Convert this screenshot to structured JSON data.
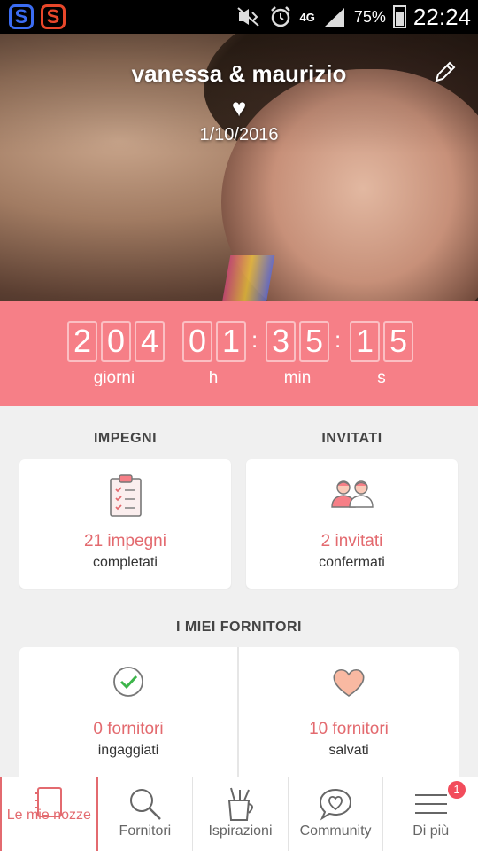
{
  "status_bar": {
    "app1_letter": "S",
    "app2_letter": "S",
    "network": "4G",
    "battery": "75%",
    "time": "22:24"
  },
  "hero": {
    "couple_names": "vanessa & maurizio",
    "heart_icon": "heart-icon",
    "date": "1/10/2016",
    "edit_icon": "pencil-icon"
  },
  "countdown": {
    "days_digits": [
      "2",
      "0",
      "4"
    ],
    "hours_digits": [
      "0",
      "1"
    ],
    "minutes_digits": [
      "3",
      "5"
    ],
    "seconds_digits": [
      "1",
      "5"
    ],
    "separator": ":",
    "labels": {
      "days": "giorni",
      "hours": "h",
      "minutes": "min",
      "seconds": "s"
    }
  },
  "impegni": {
    "title": "IMPEGNI",
    "count": "21 impegni",
    "sub": "completati",
    "icon": "checklist-icon"
  },
  "invitati": {
    "title": "INVITATI",
    "count": "2 invitati",
    "sub": "confermati",
    "icon": "guests-icon"
  },
  "fornitori": {
    "title": "I MIEI FORNITORI",
    "engaged": {
      "count": "0 fornitori",
      "sub": "ingaggiati",
      "icon": "check-circle-icon"
    },
    "saved": {
      "count": "10 fornitori",
      "sub": "salvati",
      "icon": "heart-icon"
    }
  },
  "bottom_nav": {
    "items": [
      {
        "label": "Le mie nozze",
        "icon": "notebook-icon",
        "active": true
      },
      {
        "label": "Fornitori",
        "icon": "search-icon"
      },
      {
        "label": "Ispirazioni",
        "icon": "pencil-cup-icon"
      },
      {
        "label": "Community",
        "icon": "chat-heart-icon"
      },
      {
        "label": "Di più",
        "icon": "menu-icon",
        "badge": "1"
      }
    ]
  },
  "colors": {
    "accent": "#f67f87",
    "text_accent": "#e36a6f"
  }
}
